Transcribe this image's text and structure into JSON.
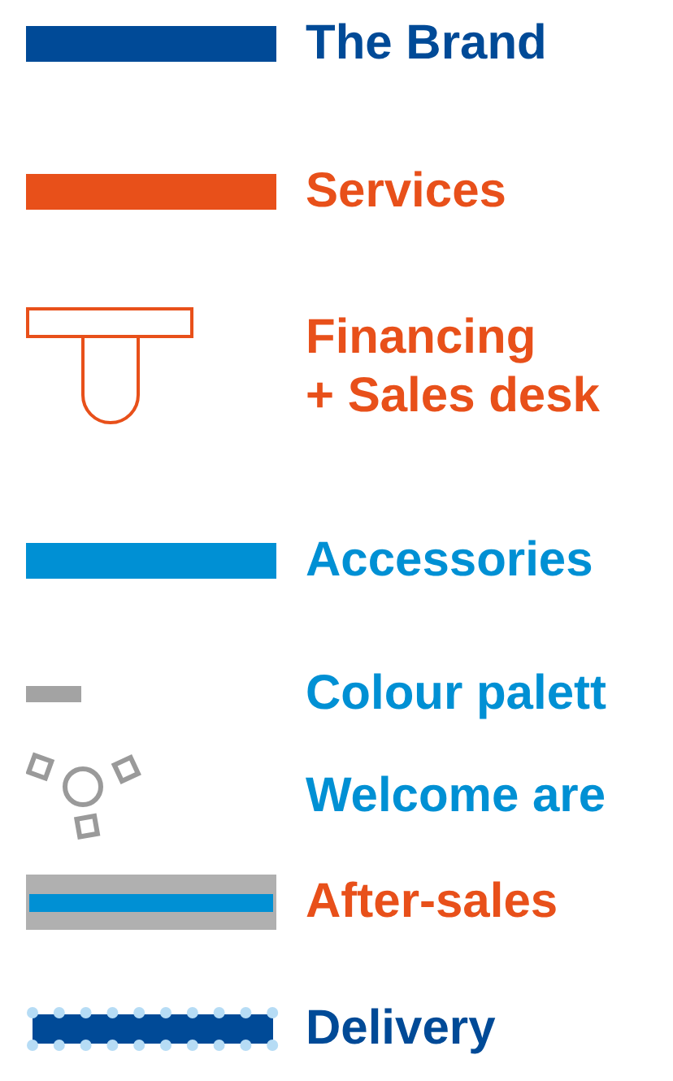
{
  "legend": [
    {
      "kind": "bar",
      "label": "The Brand",
      "color": "#004a97"
    },
    {
      "kind": "bar",
      "label": "Services",
      "color": "#e8501a"
    },
    {
      "kind": "desk",
      "label": "Financing\n+ Sales desk",
      "color": "#e8501a"
    },
    {
      "kind": "bar",
      "label": "Accessories",
      "color": "#0090d4"
    },
    {
      "kind": "short-bar",
      "label": "Colour palett",
      "color": "#0090d4"
    },
    {
      "kind": "welcome",
      "label": "Welcome are",
      "color": "#0090d4"
    },
    {
      "kind": "double-bar",
      "label": "After-sales",
      "color": "#e8501a"
    },
    {
      "kind": "dotted-bar",
      "label": "Delivery",
      "color": "#004a97"
    }
  ]
}
